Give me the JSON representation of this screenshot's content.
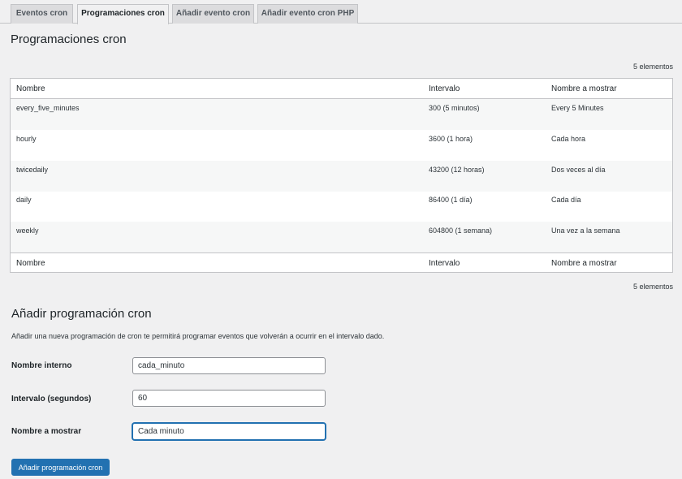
{
  "tabs": [
    {
      "label": "Eventos cron",
      "active": false
    },
    {
      "label": "Programaciones cron",
      "active": true
    },
    {
      "label": "Añadir evento cron",
      "active": false
    },
    {
      "label": "Añadir evento cron PHP",
      "active": false
    }
  ],
  "page_title": "Programaciones cron",
  "item_count": "5 elementos",
  "table": {
    "columns": [
      "Nombre",
      "Intervalo",
      "Nombre a mostrar"
    ],
    "rows": [
      [
        "every_five_minutes",
        "300 (5 minutos)",
        "Every 5 Minutes"
      ],
      [
        "hourly",
        "3600 (1 hora)",
        "Cada hora"
      ],
      [
        "twicedaily",
        "43200 (12 horas)",
        "Dos veces al día"
      ],
      [
        "daily",
        "86400 (1 día)",
        "Cada día"
      ],
      [
        "weekly",
        "604800 (1 semana)",
        "Una vez a la semana"
      ]
    ]
  },
  "add_form": {
    "title": "Añadir programación cron",
    "description": "Añadir una nueva programación de cron te permitirá programar eventos que volverán a ocurrir en el intervalo dado.",
    "fields": [
      {
        "label": "Nombre interno",
        "value": "cada_minuto"
      },
      {
        "label": "Intervalo (segundos)",
        "value": "60"
      },
      {
        "label": "Nombre a mostrar",
        "value": "Cada minuto"
      }
    ],
    "submit_label": "Añadir programación cron"
  },
  "colors": {
    "accent": "#2271b1",
    "background": "#f0f0f1",
    "border": "#c3c4c7"
  }
}
